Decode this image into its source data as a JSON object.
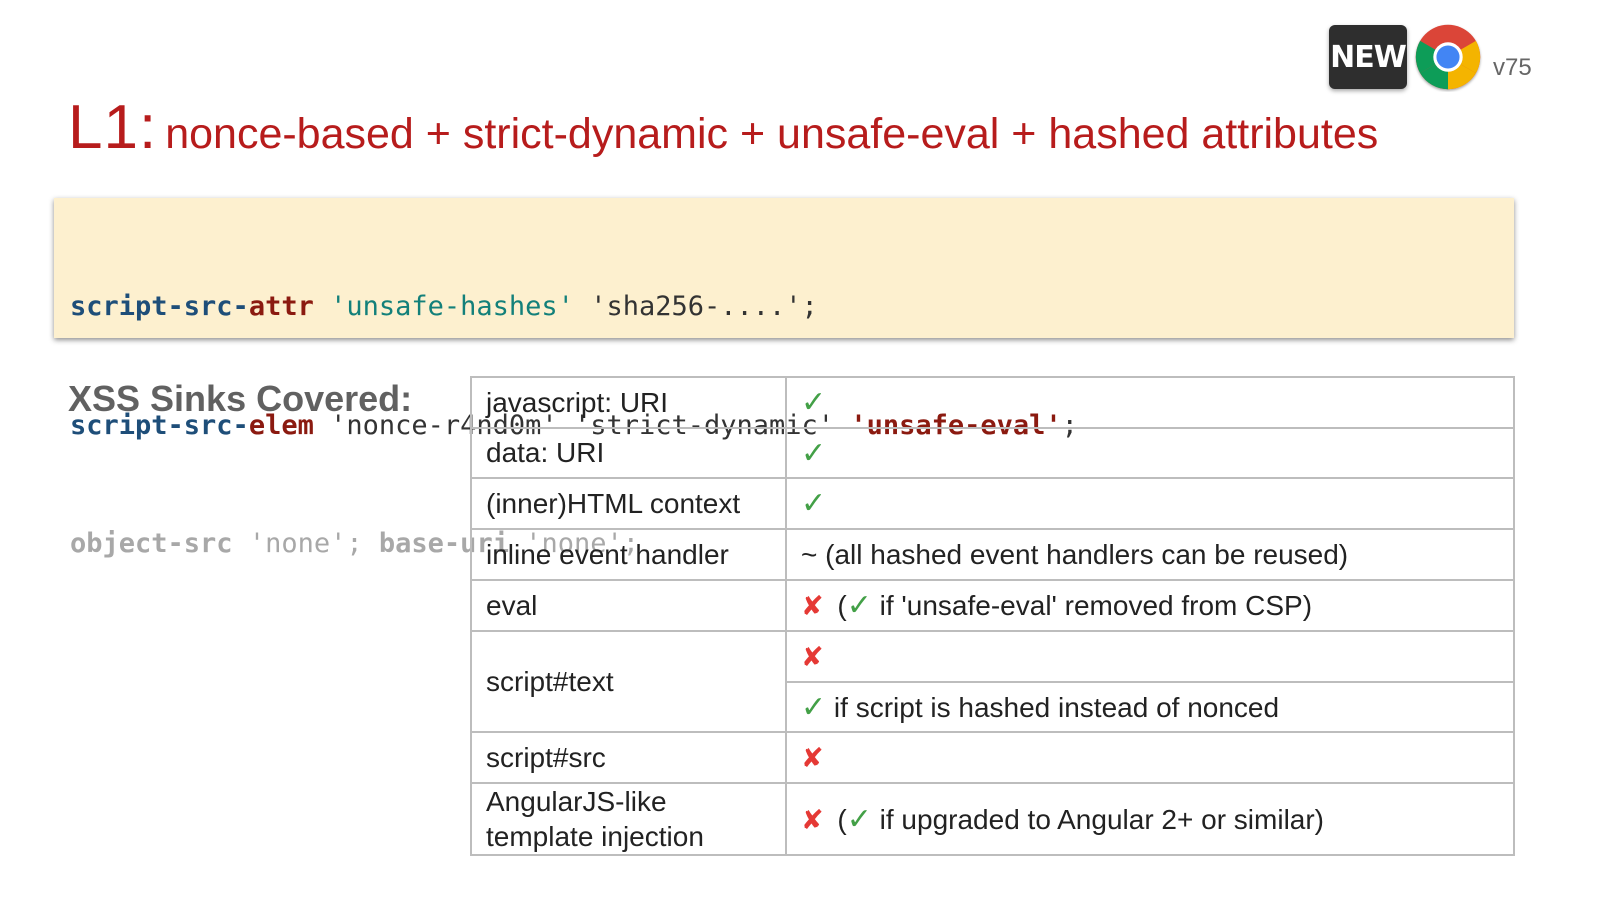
{
  "title": {
    "prefix": "L1:",
    "main": "nonce-based + strict-dynamic + unsafe-eval + hashed attributes"
  },
  "badge": {
    "new_label": "NEW",
    "version": "v75",
    "logo_icon": "chrome-logo-icon"
  },
  "code": {
    "line1": {
      "directive_a": "script-src-",
      "directive_b": "attr",
      "value1": "'unsafe-hashes'",
      "value2": "'sha256-....'",
      "end": ";"
    },
    "line2": {
      "directive_a": "script-src-",
      "directive_b": "elem",
      "value1": "'nonce-r4nd0m'",
      "value2": "'strict-dynamic'",
      "value3": "'unsafe-eval'",
      "end": ";"
    },
    "line3": {
      "directive1": "object-src",
      "value1": "'none'",
      "sep": ";",
      "directive2": "base-uri",
      "value2": "'none'",
      "end": ";"
    }
  },
  "sinks": {
    "heading": "XSS Sinks Covered:",
    "rows": [
      {
        "name": "javascript: URI"
      },
      {
        "name": "data: URI"
      },
      {
        "name": "(inner)HTML context"
      },
      {
        "name": "inline event handler",
        "note": "~ (all hashed event handlers can be reused)"
      },
      {
        "name": "eval",
        "note_open": "(",
        "note_text": "if 'unsafe-eval' removed from CSP)"
      },
      {
        "name": "script#text",
        "note_text": "if script is hashed instead of nonced"
      },
      {
        "name": "script#src"
      },
      {
        "name_line1": "AngularJS-like",
        "name_line2": "template injection",
        "note_open": "(",
        "note_text": "if upgraded to Angular 2+ or similar)"
      }
    ]
  },
  "icons": {
    "check": "✓",
    "cross": "✘"
  },
  "colors": {
    "title": "#b71c1c",
    "check": "#43a047",
    "cross": "#e53935",
    "code_bg": "#fdf0cf"
  }
}
